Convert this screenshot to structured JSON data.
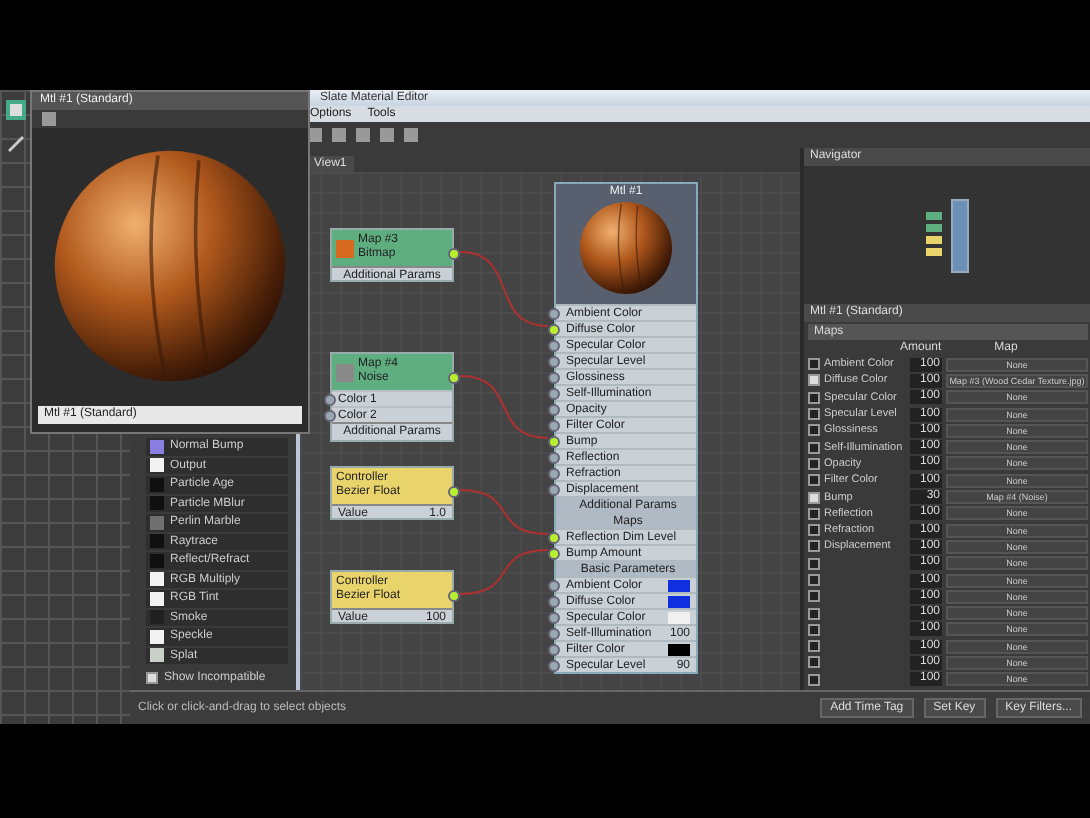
{
  "preview_window": {
    "title": "Mtl #1 (Standard)",
    "dropdown": "Mtl #1 (Standard)"
  },
  "slate": {
    "title": "Slate Material Editor",
    "menu": [
      "Options",
      "Tools"
    ],
    "view_tab": "View1",
    "browser": {
      "items": [
        {
          "label": "Normal Bump",
          "color": "#8a7fe0"
        },
        {
          "label": "Output",
          "color": "#f2f2f2"
        },
        {
          "label": "Particle Age",
          "color": "#101010"
        },
        {
          "label": "Particle MBlur",
          "color": "#101010"
        },
        {
          "label": "Perlin Marble",
          "color": "#707070"
        },
        {
          "label": "Raytrace",
          "color": "#101010"
        },
        {
          "label": "Reflect/Refract",
          "color": "#101010"
        },
        {
          "label": "RGB Multiply",
          "color": "#f2f2f2"
        },
        {
          "label": "RGB Tint",
          "color": "#f2f2f2"
        },
        {
          "label": "Smoke",
          "color": "#202020"
        },
        {
          "label": "Speckle",
          "color": "#f2f2f2"
        },
        {
          "label": "Splat",
          "color": "#c8d0c8"
        }
      ],
      "show_incompatible": {
        "label": "Show Incompatible",
        "checked": true
      }
    },
    "nodes": [
      {
        "kind": "map",
        "title": "Map #3",
        "subtitle": "Bitmap",
        "footer": "Additional Params"
      },
      {
        "kind": "map",
        "title": "Map #4",
        "subtitle": "Noise",
        "inputs": [
          "Color 1",
          "Color 2"
        ],
        "footer": "Additional Params"
      },
      {
        "kind": "controller",
        "title": "Controller",
        "subtitle": "Bezier Float",
        "value_label": "Value",
        "value": "1.0"
      },
      {
        "kind": "controller",
        "title": "Controller",
        "subtitle": "Bezier Float",
        "value_label": "Value",
        "value": "100"
      }
    ],
    "material": {
      "title": "Mtl #1",
      "slots": [
        {
          "kind": "slot",
          "label": "Ambient Color",
          "connected": false
        },
        {
          "kind": "slot",
          "label": "Diffuse Color",
          "connected": true
        },
        {
          "kind": "slot",
          "label": "Specular Color",
          "connected": false
        },
        {
          "kind": "slot",
          "label": "Specular Level",
          "connected": false
        },
        {
          "kind": "slot",
          "label": "Glossiness",
          "connected": false
        },
        {
          "kind": "slot",
          "label": "Self-Illumination",
          "connected": false
        },
        {
          "kind": "slot",
          "label": "Opacity",
          "connected": false
        },
        {
          "kind": "slot",
          "label": "Filter Color",
          "connected": false
        },
        {
          "kind": "slot",
          "label": "Bump",
          "connected": true
        },
        {
          "kind": "slot",
          "label": "Reflection",
          "connected": false
        },
        {
          "kind": "slot",
          "label": "Refraction",
          "connected": false
        },
        {
          "kind": "slot",
          "label": "Displacement",
          "connected": false
        },
        {
          "kind": "header",
          "label": "Additional Params"
        },
        {
          "kind": "header",
          "label": "Maps"
        },
        {
          "kind": "slot",
          "label": "Reflection Dim Level",
          "connected": true
        },
        {
          "kind": "slot",
          "label": "Bump Amount",
          "connected": true
        },
        {
          "kind": "header",
          "label": "Basic Parameters"
        },
        {
          "kind": "swatch",
          "label": "Ambient Color",
          "color": "#1030e0"
        },
        {
          "kind": "swatch",
          "label": "Diffuse Color",
          "color": "#1030e0"
        },
        {
          "kind": "swatch",
          "label": "Specular Color",
          "color": "#f0f0f0"
        },
        {
          "kind": "value",
          "label": "Self-Illumination",
          "value": "100"
        },
        {
          "kind": "swatch",
          "label": "Filter Color",
          "color": "#000000"
        },
        {
          "kind": "value",
          "label": "Specular Level",
          "value": "90"
        }
      ]
    },
    "navigator": {
      "title": "Navigator"
    },
    "params": {
      "title": "Mtl #1 (Standard)",
      "rollout": "Maps",
      "columns": [
        "Amount",
        "Map"
      ],
      "rows": [
        {
          "kind": "named",
          "label": "Ambient Color",
          "checked": false,
          "amount": "100",
          "map": "None"
        },
        {
          "kind": "named",
          "label": "Diffuse Color",
          "checked": true,
          "amount": "100",
          "map": "Map #3 (Wood Cedar Texture.jpg)"
        },
        {
          "kind": "named",
          "label": "Specular Color",
          "checked": false,
          "amount": "100",
          "map": "None"
        },
        {
          "kind": "named",
          "label": "Specular Level",
          "checked": false,
          "amount": "100",
          "map": "None"
        },
        {
          "kind": "named",
          "label": "Glossiness",
          "checked": false,
          "amount": "100",
          "map": "None"
        },
        {
          "kind": "named",
          "label": "Self-Illumination",
          "checked": false,
          "amount": "100",
          "map": "None"
        },
        {
          "kind": "named",
          "label": "Opacity",
          "checked": false,
          "amount": "100",
          "map": "None"
        },
        {
          "kind": "named",
          "label": "Filter Color",
          "checked": false,
          "amount": "100",
          "map": "None"
        },
        {
          "kind": "named",
          "label": "Bump",
          "checked": true,
          "amount": "30",
          "map": "Map #4 (Noise)"
        },
        {
          "kind": "named",
          "label": "Reflection",
          "checked": false,
          "amount": "100",
          "map": "None"
        },
        {
          "kind": "named",
          "label": "Refraction",
          "checked": false,
          "amount": "100",
          "map": "None"
        },
        {
          "kind": "named",
          "label": "Displacement",
          "checked": false,
          "amount": "100",
          "map": "None"
        },
        {
          "kind": "extra",
          "checked": false,
          "amount": "100",
          "map": "None"
        },
        {
          "kind": "extra",
          "checked": false,
          "amount": "100",
          "map": "None"
        },
        {
          "kind": "extra",
          "checked": false,
          "amount": "100",
          "map": "None"
        },
        {
          "kind": "extra",
          "checked": false,
          "amount": "100",
          "map": "None"
        },
        {
          "kind": "extra",
          "checked": false,
          "amount": "100",
          "map": "None"
        },
        {
          "kind": "extra",
          "checked": false,
          "amount": "100",
          "map": "None"
        },
        {
          "kind": "extra",
          "checked": false,
          "amount": "100",
          "map": "None"
        },
        {
          "kind": "extra",
          "checked": false,
          "amount": "100",
          "map": "None"
        }
      ]
    },
    "status": {
      "text": "Click or click-and-drag to select objects",
      "buttons": [
        "Add Time Tag",
        "Set Key",
        "Key Filters..."
      ]
    }
  }
}
